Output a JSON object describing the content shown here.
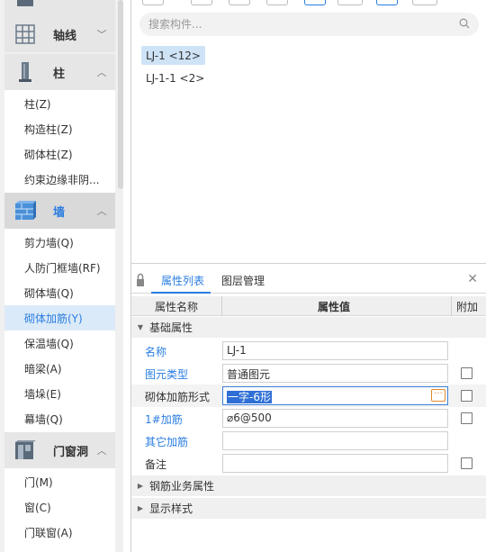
{
  "sidebar": {
    "categories": [
      {
        "label": "轴线",
        "icon": "grid-icon"
      },
      {
        "label": "柱",
        "icon": "column-icon"
      },
      {
        "label": "墙",
        "icon": "wall-icon"
      },
      {
        "label": "门窗洞",
        "icon": "door-window-icon"
      }
    ],
    "column_items": [
      "柱(Z)",
      "构造柱(Z)",
      "砌体柱(Z)",
      "约束边缘非阴..."
    ],
    "wall_items": [
      "剪力墙(Q)",
      "人防门框墙(RF)",
      "砌体墙(Q)",
      "砌体加筋(Y)",
      "保温墙(Q)",
      "暗梁(A)",
      "墙垛(E)",
      "幕墙(Q)"
    ],
    "door_items": [
      "门(M)",
      "窗(C)",
      "门联窗(A)"
    ],
    "selected": "砌体加筋(Y)"
  },
  "search": {
    "placeholder": "搜索构件..."
  },
  "components": [
    {
      "label": "LJ-1 <12>"
    },
    {
      "label": "LJ-1-1 <2>"
    }
  ],
  "properties": {
    "tabs": [
      "属性列表",
      "图层管理"
    ],
    "columns": {
      "name": "属性名称",
      "value": "属性值",
      "extra": "附加"
    },
    "groups": {
      "basic": "基础属性",
      "rebar": "钢筋业务属性",
      "display": "显示样式"
    },
    "rows": [
      {
        "name": "名称",
        "value": "LJ-1"
      },
      {
        "name": "图元类型",
        "value": "普通图元"
      },
      {
        "name": "砌体加筋形式",
        "value": "一字-6形"
      },
      {
        "name": "1#加筋",
        "value": "⌀6@500"
      },
      {
        "name": "其它加筋",
        "value": ""
      },
      {
        "name": "备注",
        "value": ""
      }
    ]
  },
  "colors": {
    "accent": "#2a7de1",
    "selected_bg": "#dbeaf8",
    "ellipsis": "#e08a2b"
  }
}
